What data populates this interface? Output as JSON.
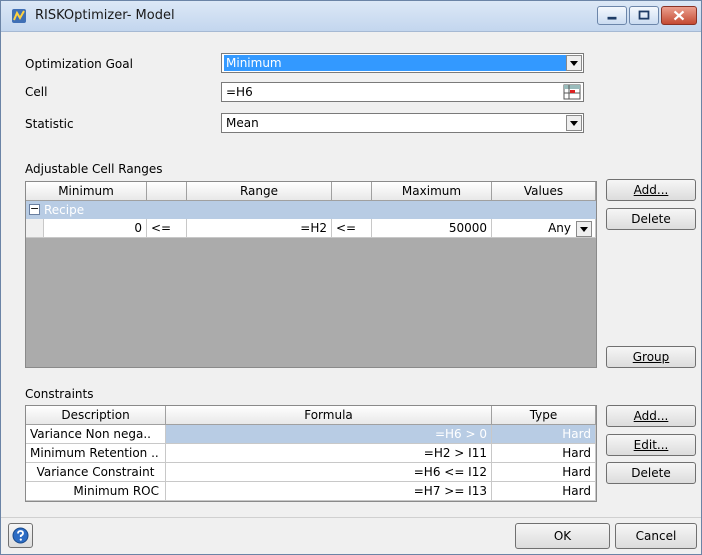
{
  "window": {
    "title": "RISKOptimizer- Model",
    "accent": "#3399ff"
  },
  "goal": {
    "optimization_goal_label": "Optimization Goal",
    "optimization_goal_value": "Minimum",
    "cell_label": "Cell",
    "cell_value": "=H6",
    "statistic_label": "Statistic",
    "statistic_value": "Mean"
  },
  "adjustable": {
    "section_label": "Adjustable Cell Ranges",
    "headers": {
      "minimum": "Minimum",
      "range": "Range",
      "maximum": "Maximum",
      "values": "Values"
    },
    "group_label": "Recipe",
    "group_toggle": "−",
    "row": {
      "min": "0",
      "op1": "<=",
      "range": "=H2",
      "op2": "<=",
      "max": "50000",
      "values": "Any"
    },
    "buttons": {
      "add": "Add...",
      "delete": "Delete",
      "group": "Group"
    }
  },
  "constraints": {
    "section_label": "Constraints",
    "headers": {
      "description": "Description",
      "formula": "Formula",
      "type": "Type"
    },
    "rows": [
      {
        "description": "Variance Non nega..",
        "formula": "=H6 > 0",
        "type": "Hard"
      },
      {
        "description": "Minimum Retention ..",
        "formula": "=H2 > I11",
        "type": "Hard"
      },
      {
        "description": "Variance Constraint",
        "formula": "=H6 <= I12",
        "type": "Hard"
      },
      {
        "description": "Minimum ROC",
        "formula": "=H7 >= I13",
        "type": "Hard"
      }
    ],
    "buttons": {
      "add": "Add...",
      "edit": "Edit...",
      "delete": "Delete"
    }
  },
  "footer": {
    "ok": "OK",
    "cancel": "Cancel"
  }
}
